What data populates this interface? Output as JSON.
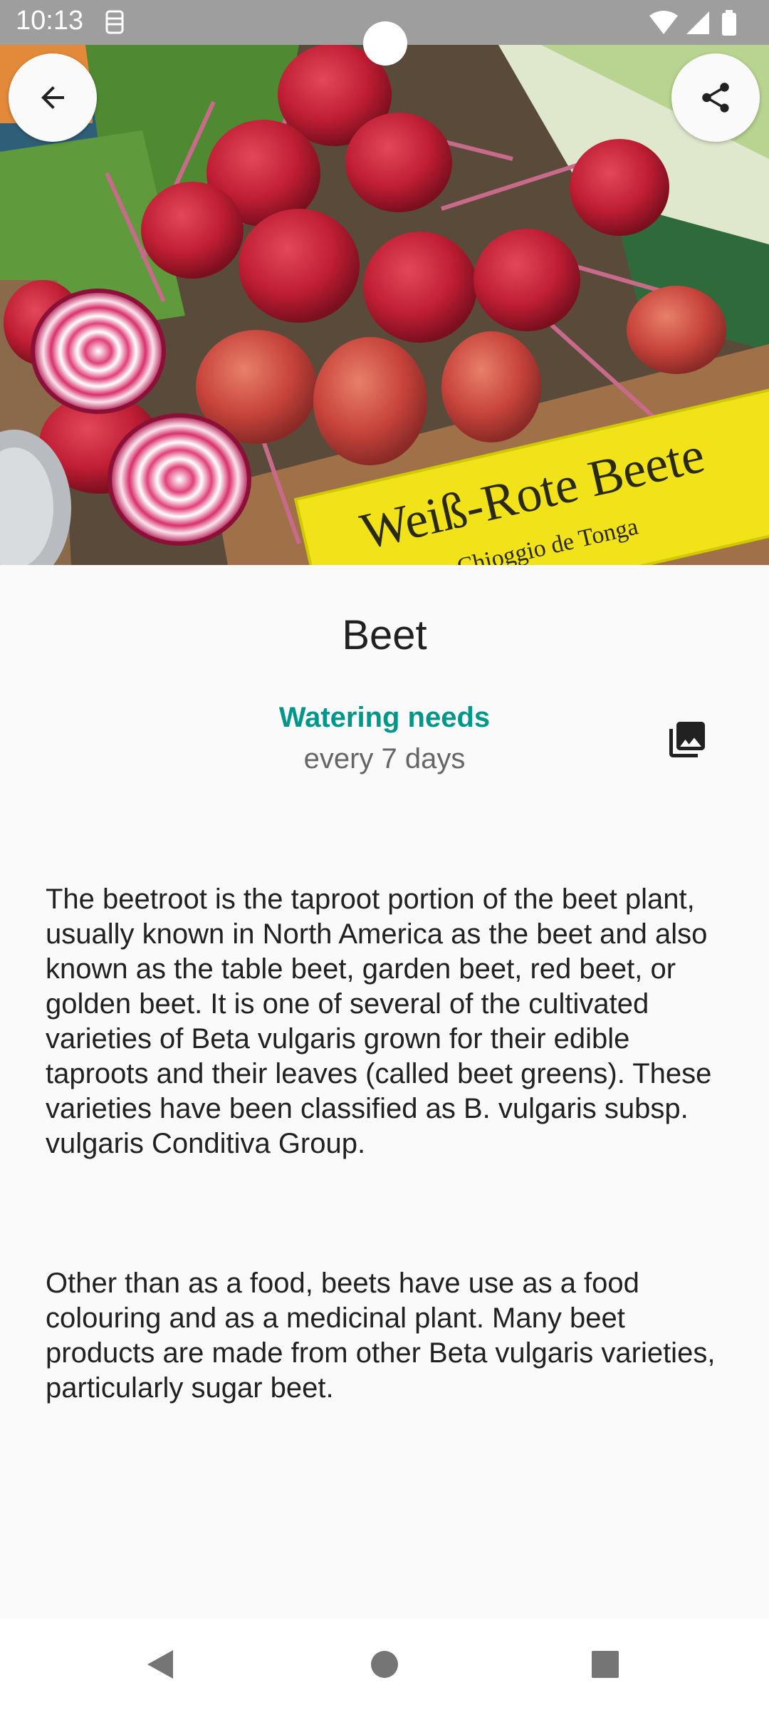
{
  "status_bar": {
    "time": "10:13"
  },
  "plant": {
    "name": "Beet",
    "watering_label": "Watering needs",
    "watering_value": "every 7 days",
    "description_paragraphs": [
      "The beetroot is the taproot portion of the beet plant, usually known in North America as the beet and also known as the table beet, garden beet, red beet, or golden beet. It is one of several of the cultivated varieties of Beta vulgaris grown for their edible taproots and their leaves (called beet greens). These varieties have been classified as B. vulgaris subsp. vulgaris Conditiva Group.",
      "Other than as a food, beets have use as a food colouring and as a medicinal plant. Many beet products are made from other Beta vulgaris varieties, particularly sugar beet."
    ]
  },
  "hero_image": {
    "sign_text": "Weiß-Rote Beete",
    "sign_subtext": "Chioggio de Tonga"
  },
  "icons": {
    "back": "arrow-back-icon",
    "share": "share-icon",
    "gallery": "photo-library-icon"
  },
  "colors": {
    "accent": "#00968a",
    "status_bar": "#9e9e9e",
    "background": "#fafafa"
  }
}
